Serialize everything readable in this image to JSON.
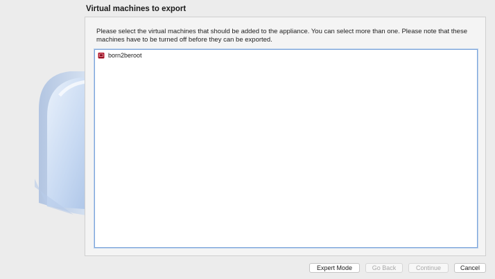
{
  "page": {
    "title": "Virtual machines to export",
    "description": "Please select the virtual machines that should be added to the appliance. You can select more than one. Please note that these machines have to be turned off before they can be exported."
  },
  "vm_list": {
    "items": [
      {
        "name": "born2beroot",
        "icon": "vm-icon"
      }
    ]
  },
  "buttons": {
    "expert_mode": "Expert Mode",
    "go_back": "Go Back",
    "continue": "Continue",
    "cancel": "Cancel"
  }
}
